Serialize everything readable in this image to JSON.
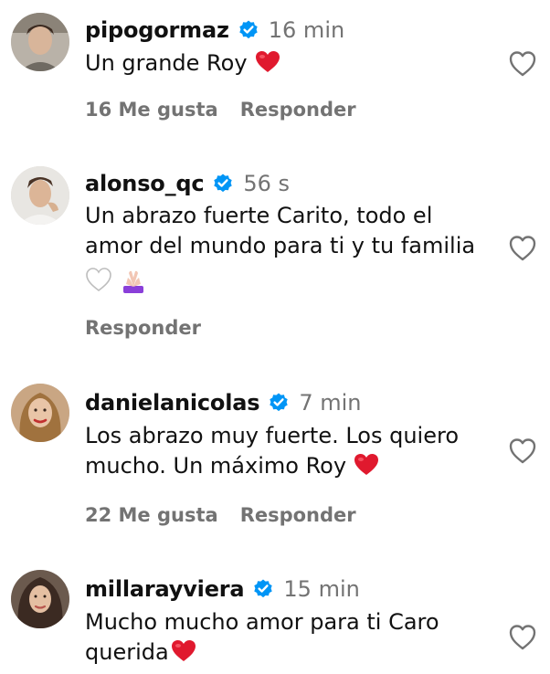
{
  "comments": [
    {
      "username": "pipogormaz",
      "verified": true,
      "timestamp": "16 min",
      "text": "Un grande Roy",
      "emojis": [
        "red-heart"
      ],
      "likes": "16 Me gusta",
      "reply_label": "Responder",
      "like_icon": "heart-outline-icon"
    },
    {
      "username": "alonso_qc",
      "verified": true,
      "timestamp": "56 s",
      "text": "Un abrazo fuerte Carito, todo el amor del mundo para ti y tu familia",
      "emojis": [
        "white-heart",
        "folded-hands"
      ],
      "likes": "",
      "reply_label": "Responder",
      "like_icon": "heart-outline-icon"
    },
    {
      "username": "danielanicolas",
      "verified": true,
      "timestamp": "7 min",
      "text": "Los abrazo muy fuerte. Los quiero mucho. Un máximo Roy",
      "emojis": [
        "red-heart"
      ],
      "likes": "22 Me gusta",
      "reply_label": "Responder",
      "like_icon": "heart-outline-icon"
    },
    {
      "username": "millarayviera",
      "verified": true,
      "timestamp": "15 min",
      "text": "Mucho mucho amor para ti Caro querida",
      "emojis": [
        "red-heart"
      ],
      "likes": "",
      "reply_label": "",
      "like_icon": "heart-outline-icon"
    }
  ],
  "colors": {
    "verified_badge": "#0095f6",
    "secondary_text": "#737373",
    "emoji_heart": "#e0192e",
    "background": "#ffffff"
  }
}
